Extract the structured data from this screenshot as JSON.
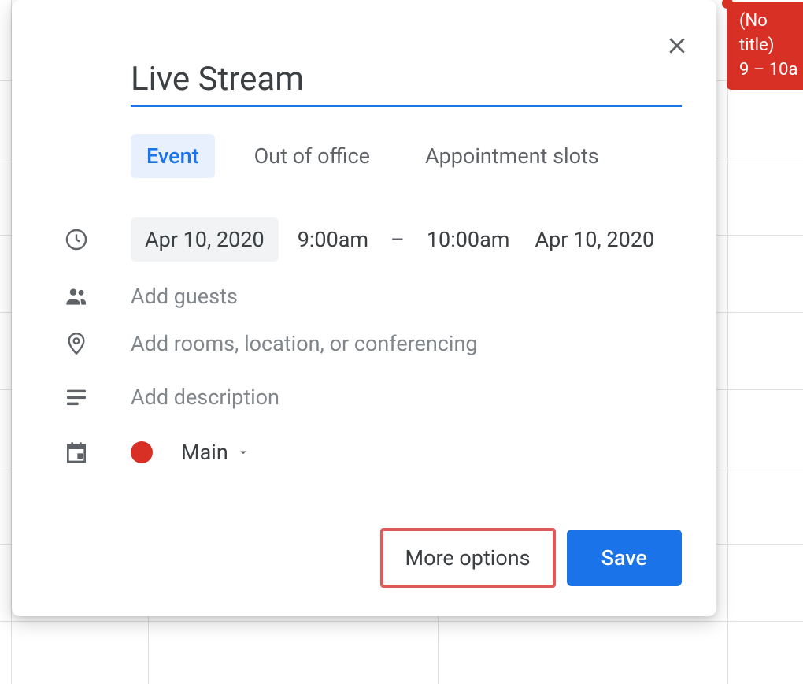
{
  "bg_event": {
    "title": "(No title)",
    "time": "9 – 10a"
  },
  "modal": {
    "title_value": "Live Stream",
    "tabs": {
      "event": "Event",
      "out_of_office": "Out of office",
      "appointment_slots": "Appointment slots"
    },
    "datetime": {
      "start_date": "Apr 10, 2020",
      "start_time": "9:00am",
      "dash": "–",
      "end_time": "10:00am",
      "end_date": "Apr 10, 2020"
    },
    "guests_placeholder": "Add guests",
    "location_placeholder": "Add rooms, location, or conferencing",
    "description_placeholder": "Add description",
    "calendar": {
      "name": "Main",
      "color": "#d93025"
    },
    "footer": {
      "more_options": "More options",
      "save": "Save"
    }
  }
}
